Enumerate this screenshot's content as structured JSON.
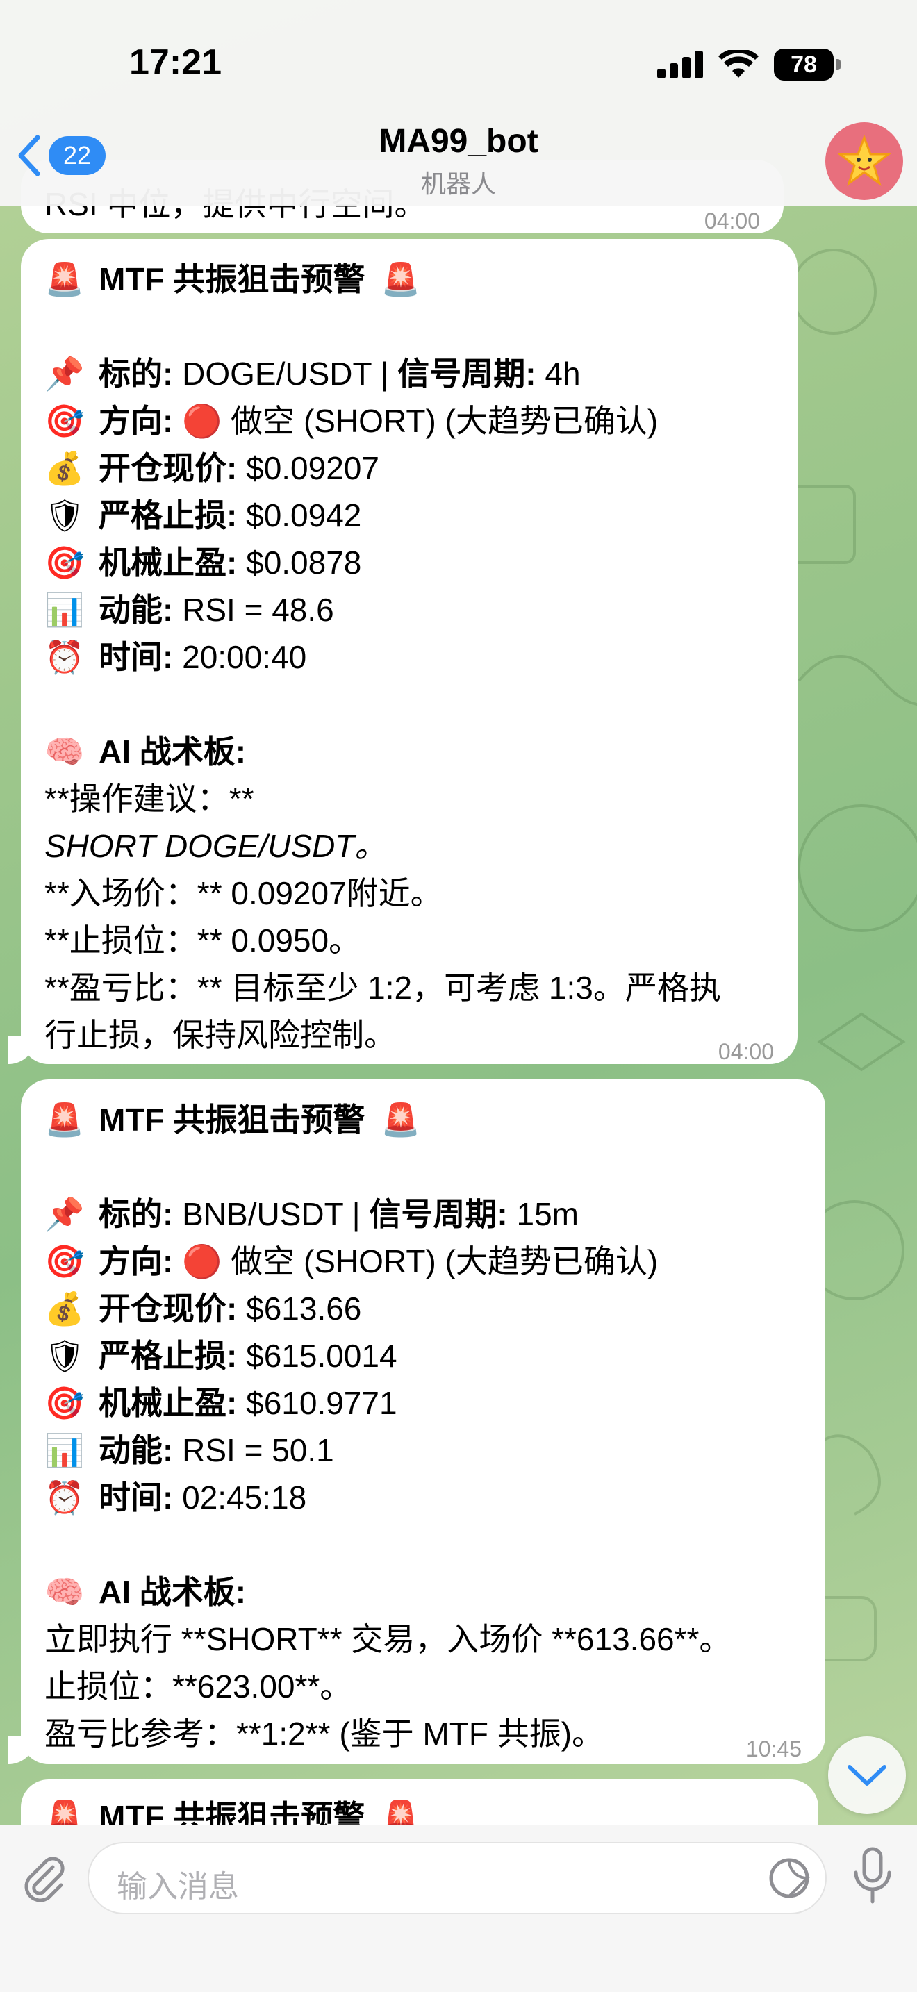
{
  "status": {
    "time": "17:21",
    "battery": "78"
  },
  "header": {
    "back_count": "22",
    "title": "MA99_bot",
    "subtitle": "机器人"
  },
  "top_partial": {
    "text": "RSI 中位，提供中行空间。",
    "time": "04:00"
  },
  "messages": [
    {
      "title": "MTF 共振狙击预警",
      "symbol_label": "标的:",
      "symbol": "DOGE/USDT",
      "period_label": "信号周期:",
      "period": "4h",
      "direction_label": "方向:",
      "direction": "做空 (SHORT) (大趋势已确认)",
      "entry_label": "开仓现价:",
      "entry": "$0.09207",
      "sl_label": "严格止损:",
      "sl": "$0.0942",
      "tp_label": "机械止盈:",
      "tp": "$0.0878",
      "momentum_label": "动能:",
      "momentum": "RSI = 48.6",
      "time_label": "时间:",
      "time_value": "20:00:40",
      "ai_label": "AI 战术板:",
      "ai_lines": [
        "**操作建议：**",
        "SHORT DOGE/USDT。",
        "**入场价：** 0.09207附近。",
        "**止损位：** 0.0950。",
        "**盈亏比：** 目标至少 1:2，可考虑 1:3。严格执",
        "行止损，保持风险控制。"
      ],
      "timestamp": "04:00"
    },
    {
      "title": "MTF 共振狙击预警",
      "symbol_label": "标的:",
      "symbol": "BNB/USDT",
      "period_label": "信号周期:",
      "period": "15m",
      "direction_label": "方向:",
      "direction": "做空 (SHORT) (大趋势已确认)",
      "entry_label": "开仓现价:",
      "entry": "$613.66",
      "sl_label": "严格止损:",
      "sl": "$615.0014",
      "tp_label": "机械止盈:",
      "tp": "$610.9771",
      "momentum_label": "动能:",
      "momentum": "RSI = 50.1",
      "time_label": "时间:",
      "time_value": "02:45:18",
      "ai_label": "AI 战术板:",
      "ai_lines": [
        "立即执行 **SHORT** 交易，入场价 **613.66**。",
        "止损位：**623.00**。",
        "盈亏比参考：**1:2** (鉴于 MTF 共振)。"
      ],
      "timestamp": "10:45"
    },
    {
      "title": "MTF 共振狙击预警"
    }
  ],
  "composer": {
    "placeholder": "输入消息"
  },
  "icons": {
    "siren": "🚨",
    "pin": "📌",
    "target": "🎯",
    "money": "💰",
    "shield": "🛡",
    "chart": "📊",
    "clock": "⏰",
    "brain": "🧠",
    "red_circle": "🔴"
  }
}
